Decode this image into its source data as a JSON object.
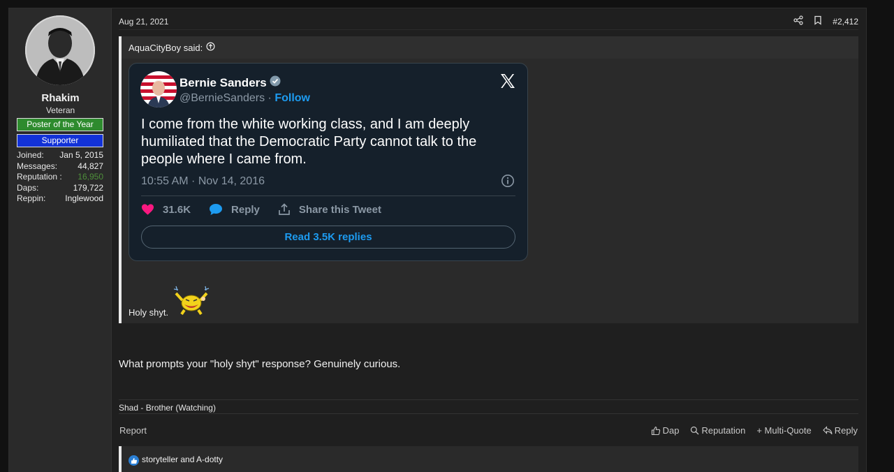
{
  "user": {
    "name": "Rhakim",
    "title": "Veteran",
    "banners": [
      "Poster of the Year",
      "Supporter"
    ],
    "stats": [
      {
        "label": "Joined:",
        "value": "Jan 5, 2015"
      },
      {
        "label": "Messages:",
        "value": "44,827"
      },
      {
        "label": "Reputation :",
        "value": "16,950"
      },
      {
        "label": "Daps:",
        "value": "179,722"
      },
      {
        "label": "Reppin:",
        "value": "Inglewood"
      }
    ]
  },
  "post": {
    "date": "Aug 21, 2021",
    "number": "#2,412",
    "quote": {
      "author": "AquaCityBoy said:",
      "body": "Holy shyt."
    },
    "tweet": {
      "name": "Bernie Sanders",
      "handle": "@BernieSanders",
      "separator": "·",
      "follow": "Follow",
      "text": "I come from the white working class, and I am deeply humiliated that the Democratic Party cannot talk to the people where I came from.",
      "time": "10:55 AM · Nov 14, 2016",
      "likes": "31.6K",
      "reply": "Reply",
      "share": "Share this Tweet",
      "read_replies": "Read 3.5K replies"
    },
    "text": "What prompts your \"holy shyt\" response? Genuinely curious.",
    "signature": "Shad - Brother (Watching)",
    "report": "Report",
    "actions": {
      "dap": "Dap",
      "reputation": "Reputation",
      "multiquote": "+ Multi-Quote",
      "reply": "Reply"
    },
    "reactions": "storyteller and A-dotty"
  }
}
